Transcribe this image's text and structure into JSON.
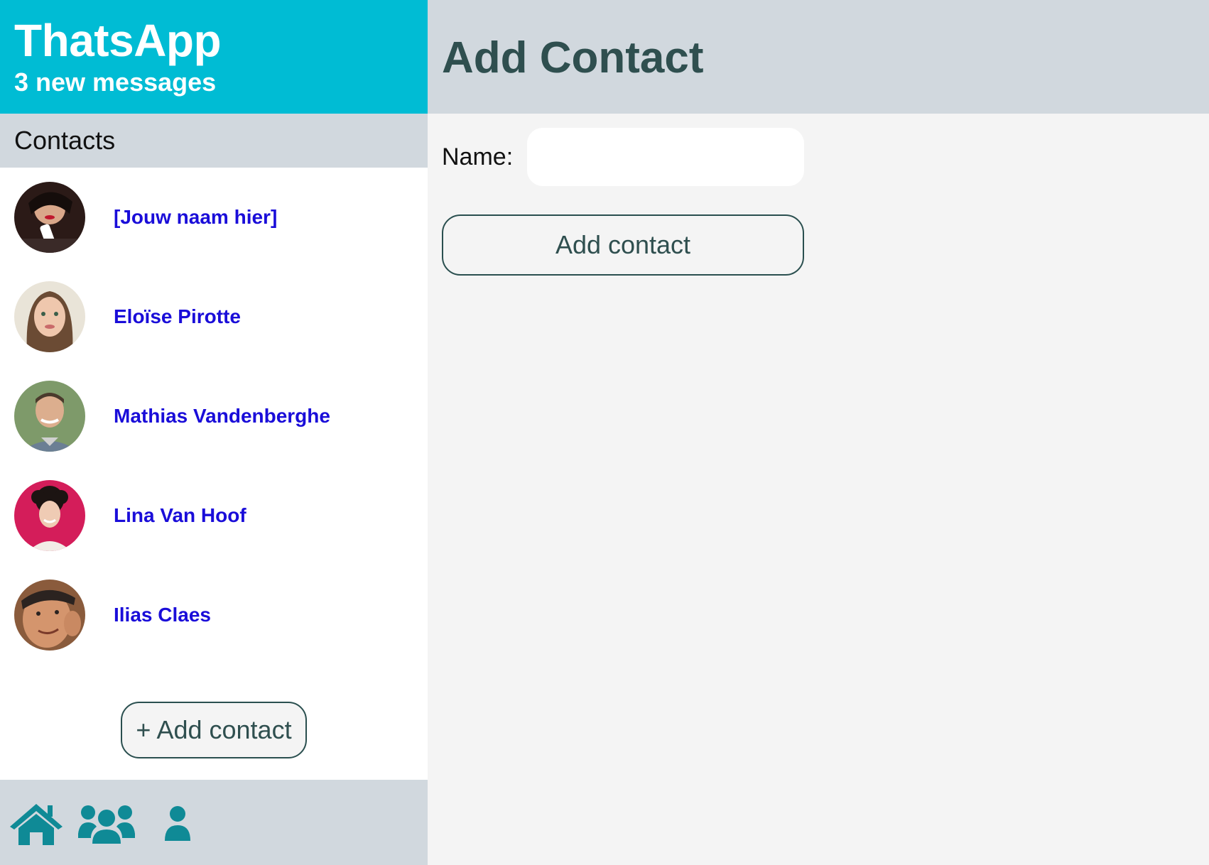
{
  "app": {
    "title": "ThatsApp",
    "subtitle": "3 new messages"
  },
  "sidebar": {
    "section_label": "Contacts",
    "contacts": [
      {
        "name": "[Jouw naam hier]",
        "avatar": "woman-red-lipstick-avatar"
      },
      {
        "name": "Eloïse Pirotte",
        "avatar": "woman-long-hair-avatar"
      },
      {
        "name": "Mathias Vandenberghe",
        "avatar": "man-smiling-avatar"
      },
      {
        "name": "Lina Van Hoof",
        "avatar": "woman-curly-hair-avatar"
      },
      {
        "name": "Ilias Claes",
        "avatar": "man-close-up-avatar"
      }
    ],
    "add_button_label": "+ Add contact"
  },
  "bottom_nav": [
    {
      "icon": "home-icon"
    },
    {
      "icon": "users-group-icon"
    },
    {
      "icon": "user-icon"
    }
  ],
  "main": {
    "title": "Add Contact",
    "form": {
      "name_label": "Name:",
      "name_value": "",
      "name_placeholder": "",
      "submit_label": "Add contact"
    }
  },
  "colors": {
    "brand": "#00bcd4",
    "header_gray": "#d1d8de",
    "link": "#1a0dd9",
    "icon_teal": "#0f8a96",
    "dark_slate": "#2f4f4f"
  }
}
